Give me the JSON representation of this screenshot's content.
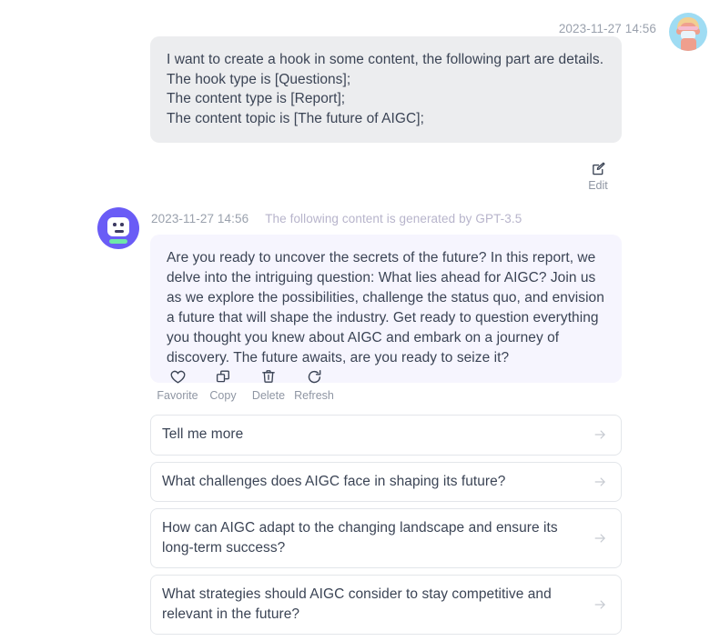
{
  "conversation": {
    "user_turn": {
      "timestamp": "2023-11-27 14:56",
      "avatar_name": "user-avatar",
      "message_lines": [
        "I want to create a hook in some content, the following part are details.",
        "The hook type is [Questions];",
        "The content type is [Report];",
        "The content topic is [The future of AIGC];"
      ],
      "edit_action": {
        "label": "Edit",
        "icon": "edit-pencil-square-icon"
      }
    },
    "bot_turn": {
      "timestamp": "2023-11-27 14:56",
      "generated_note": "The following content is generated by GPT-3.5",
      "avatar_name": "assistant-robot-avatar",
      "message": "Are you ready to uncover the secrets of the future? In this report, we delve into the intriguing question: What lies ahead for AIGC? Join us as we explore the possibilities, challenge the status quo, and envision a future that will shape the industry. Get ready to question everything you thought you knew about AIGC and embark on a journey of discovery. The future awaits, are you ready to seize it?",
      "actions": [
        {
          "label": "Favorite",
          "icon": "heart-icon"
        },
        {
          "label": "Copy",
          "icon": "copy-icon"
        },
        {
          "label": "Delete",
          "icon": "trash-icon"
        },
        {
          "label": "Refresh",
          "icon": "refresh-icon"
        }
      ],
      "suggestions": [
        {
          "text": "Tell me more",
          "arrow_icon": "arrow-right-icon"
        },
        {
          "text": "What challenges does AIGC face in shaping its future?",
          "arrow_icon": "arrow-right-icon"
        },
        {
          "text": "How can AIGC adapt to the changing landscape and ensure its long-term success?",
          "arrow_icon": "arrow-right-icon"
        },
        {
          "text": "What strategies should AIGC consider to stay competitive and relevant in the future?",
          "arrow_icon": "arrow-right-icon"
        }
      ]
    }
  },
  "colors": {
    "page_background": "#ffffff",
    "user_bubble": "#ecedef",
    "bot_bubble": "#f6f5fe",
    "text_primary": "#3b4455",
    "text_muted": "#9aa1ad",
    "accent_purple": "#6a5cf6",
    "chip_border": "#e3e6ea"
  }
}
